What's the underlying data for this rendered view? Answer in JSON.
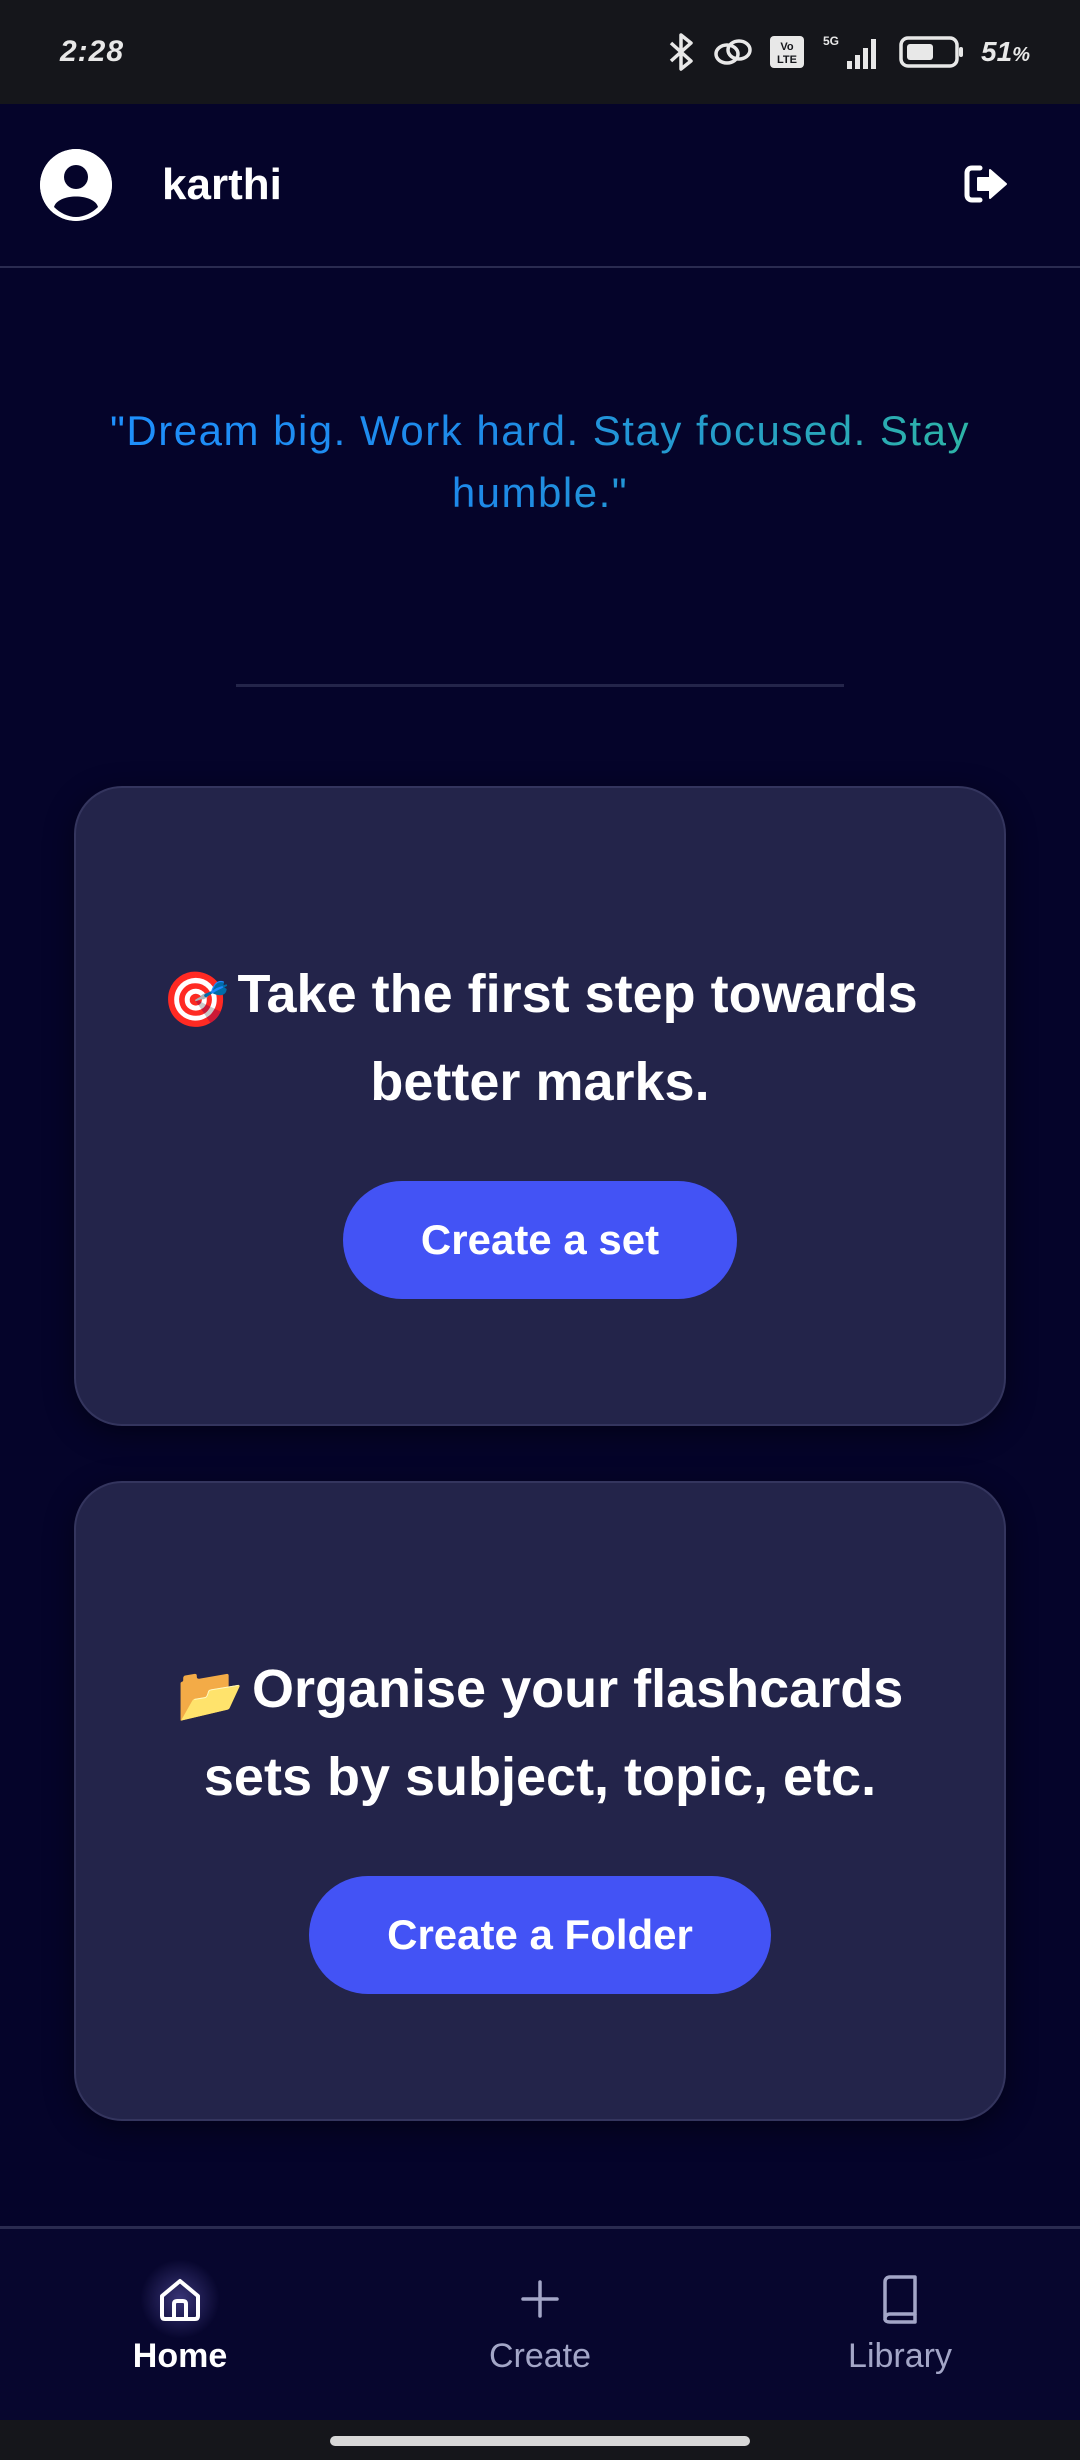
{
  "status_bar": {
    "time": "2:28",
    "battery_percent": "51",
    "battery_suffix": "%",
    "network": "5G",
    "volte": "Vo LTE"
  },
  "header": {
    "username": "karthi"
  },
  "quote": {
    "text": "\"Dream big. Work hard. Stay focused. Stay humble.\""
  },
  "cards": [
    {
      "emoji": "🎯",
      "title": "Take the first step towards better marks.",
      "button_label": "Create a set"
    },
    {
      "emoji": "📂",
      "title": "Organise your flashcards sets by subject, topic, etc.",
      "button_label": "Create a Folder"
    }
  ],
  "bottom_nav": {
    "items": [
      {
        "label": "Home",
        "icon": "home-icon",
        "active": true
      },
      {
        "label": "Create",
        "icon": "plus-icon",
        "active": false
      },
      {
        "label": "Library",
        "icon": "book-icon",
        "active": false
      }
    ]
  },
  "colors": {
    "background": "#05042a",
    "card": "#23244a",
    "accent_button": "#4353f5",
    "quote_gradient_start": "#1e90ff",
    "quote_gradient_end": "#2fb8a0"
  }
}
